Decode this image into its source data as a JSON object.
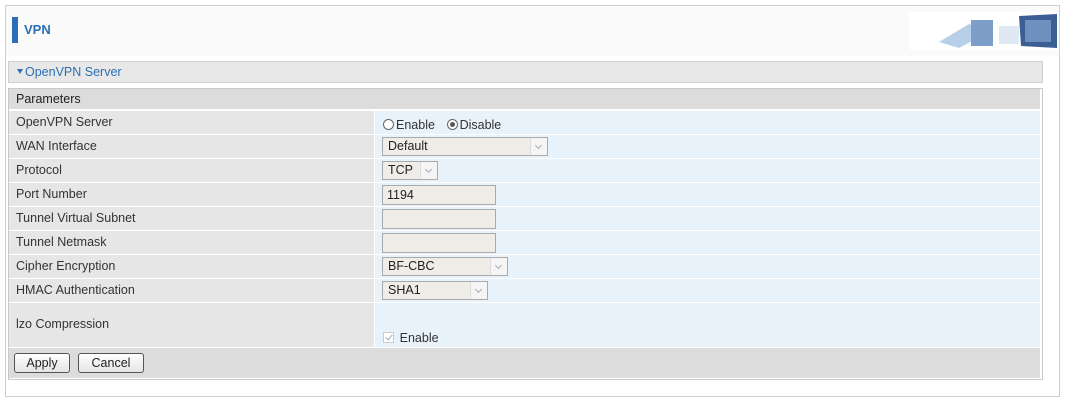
{
  "header": {
    "title": "VPN"
  },
  "section": {
    "title": "OpenVPN Server",
    "params_label": "Parameters"
  },
  "rows": {
    "server": {
      "label": "OpenVPN Server",
      "enable": "Enable",
      "disable": "Disable",
      "selected": "Disable"
    },
    "wan": {
      "label": "WAN Interface",
      "value": "Default"
    },
    "protocol": {
      "label": "Protocol",
      "value": "TCP"
    },
    "port": {
      "label": "Port Number",
      "value": "1194"
    },
    "subnet": {
      "label": "Tunnel Virtual Subnet",
      "value": ""
    },
    "netmask": {
      "label": "Tunnel Netmask",
      "value": ""
    },
    "cipher": {
      "label": "Cipher Encryption",
      "value": "BF-CBC"
    },
    "hmac": {
      "label": "HMAC Authentication",
      "value": "SHA1"
    },
    "lzo": {
      "label": "lzo Compression",
      "checkbox_label": "Enable",
      "checked": true
    }
  },
  "buttons": {
    "apply": "Apply",
    "cancel": "Cancel"
  },
  "colors": {
    "accent": "#2a6fb5",
    "label_bg": "#e6e6e6",
    "value_bg": "#e8f2fb"
  }
}
